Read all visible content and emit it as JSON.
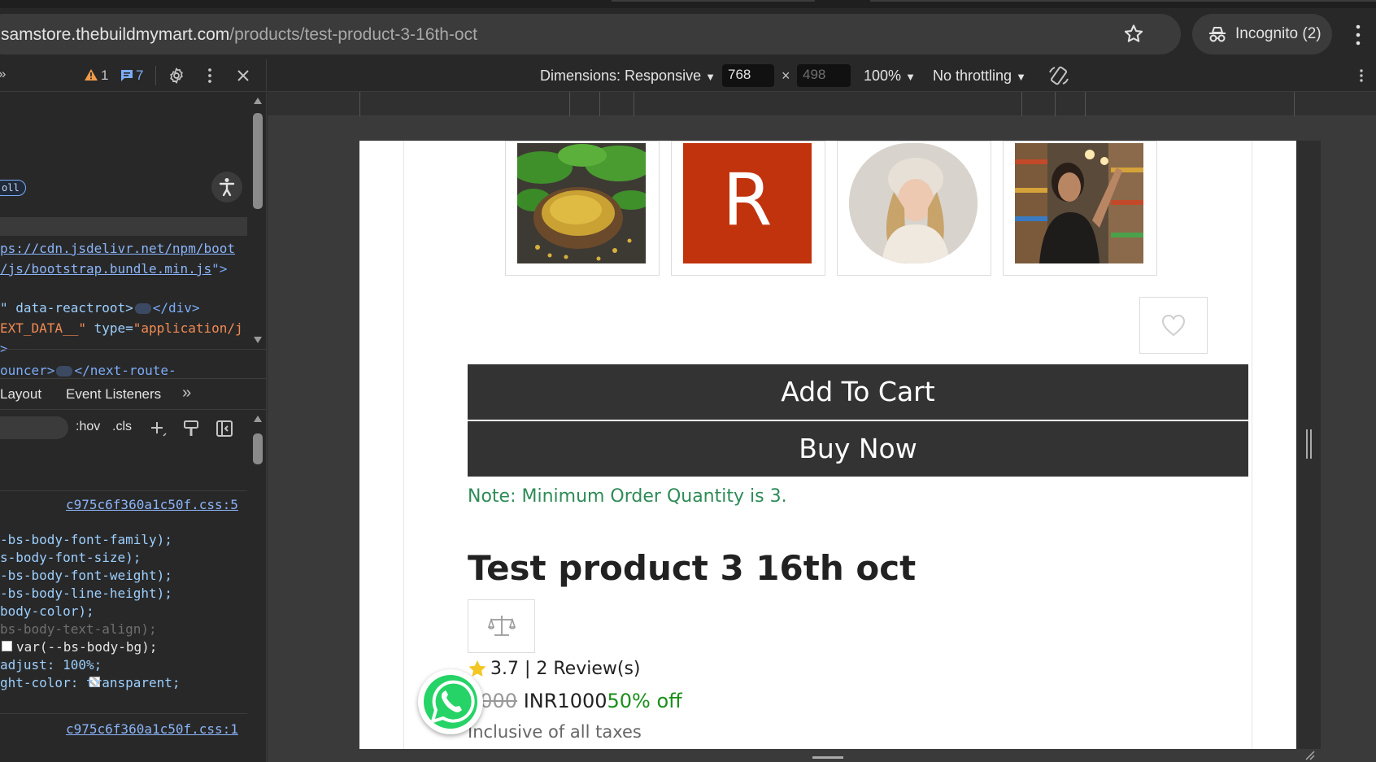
{
  "browser": {
    "url_host": "samstore.thebuildmymart.com",
    "url_path": "/products/test-product-3-16th-oct",
    "incognito_label": "Incognito (2)"
  },
  "devtools": {
    "warning_count": "1",
    "message_count": "7",
    "scroll_badge": "oll",
    "elements_lines": [
      {
        "a": "ps://cdn.jsdelivr.net/npm/boot",
        "kind": "link"
      },
      {
        "a": "/js/bootstrap.bundle.min.js",
        "b": "\">",
        "kind": "link-end"
      },
      {
        "a": "\" data-reactroot>",
        "b": "</div>",
        "kind": "ellipsis"
      },
      {
        "a": "EXT_DATA__\"",
        "b": " type=",
        "c": "\"application/j",
        "kind": "attr"
      },
      {
        "a": ">",
        "kind": "tag"
      },
      {
        "a": "ouncer>",
        "b": "</next-route-",
        "kind": "ellipsis2"
      }
    ],
    "tabs": {
      "layout": "Layout",
      "event_listeners": "Event Listeners"
    },
    "styles_toolbar": {
      "hov": ":hov",
      "cls": ".cls"
    },
    "css_source_1": "c975c6f360a1c50f.css:5",
    "css_source_2": "c975c6f360a1c50f.css:1",
    "css_lines": [
      "-bs-body-font-family);",
      "s-body-font-size);",
      "-bs-body-font-weight);",
      "-bs-body-line-height);",
      "body-color);",
      "bs-body-text-align);",
      "var(--bs-body-bg);",
      "adjust: 100%;",
      "ght-color: transparent;"
    ]
  },
  "device_toolbar": {
    "dimensions_label": "Dimensions: Responsive",
    "width": "768",
    "height": "498",
    "zoom": "100%",
    "throttling": "No throttling"
  },
  "product": {
    "add_to_cart": "Add To Cart",
    "buy_now": "Buy Now",
    "note": "Note: Minimum Order Quantity is 3.",
    "title": "Test product 3 16th oct",
    "rating_text": "3.7 | 2 Review(s)",
    "price_old": "2000",
    "price": "INR1000",
    "discount": "50% off",
    "tax_note": "Inclusive of all taxes",
    "thumbnail_letter": "R"
  },
  "colors": {
    "button_bg": "#333333",
    "note_green": "#2e8b57",
    "discount_green": "#1a8f1a",
    "thumb_red": "#c1330d"
  }
}
